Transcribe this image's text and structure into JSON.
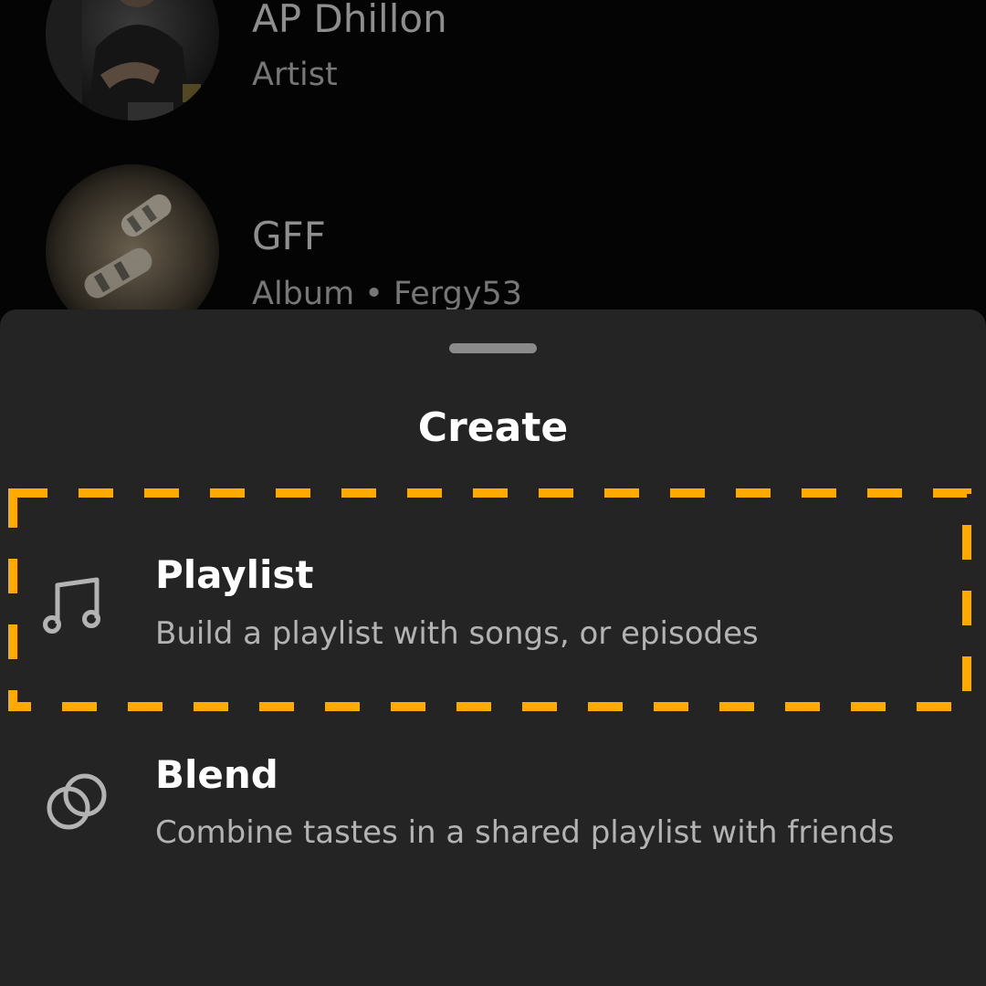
{
  "library": {
    "items": [
      {
        "title": "AP Dhillon",
        "subtitle": "Artist",
        "thumb_shape": "circle"
      },
      {
        "title": "GFF",
        "subtitle": "Album • Fergy53",
        "thumb_shape": "square"
      }
    ]
  },
  "create_sheet": {
    "title": "Create",
    "options": [
      {
        "title": "Playlist",
        "description": "Build a playlist with songs, or episodes",
        "icon": "music-note-icon",
        "highlighted": true
      },
      {
        "title": "Blend",
        "description": "Combine tastes in a shared playlist with friends",
        "icon": "blend-icon",
        "highlighted": false
      }
    ]
  },
  "colors": {
    "sheet_background": "#242424",
    "highlight_dash": "#FFAA00",
    "text_primary": "#FFFFFF",
    "text_secondary": "#B3B3B3"
  }
}
